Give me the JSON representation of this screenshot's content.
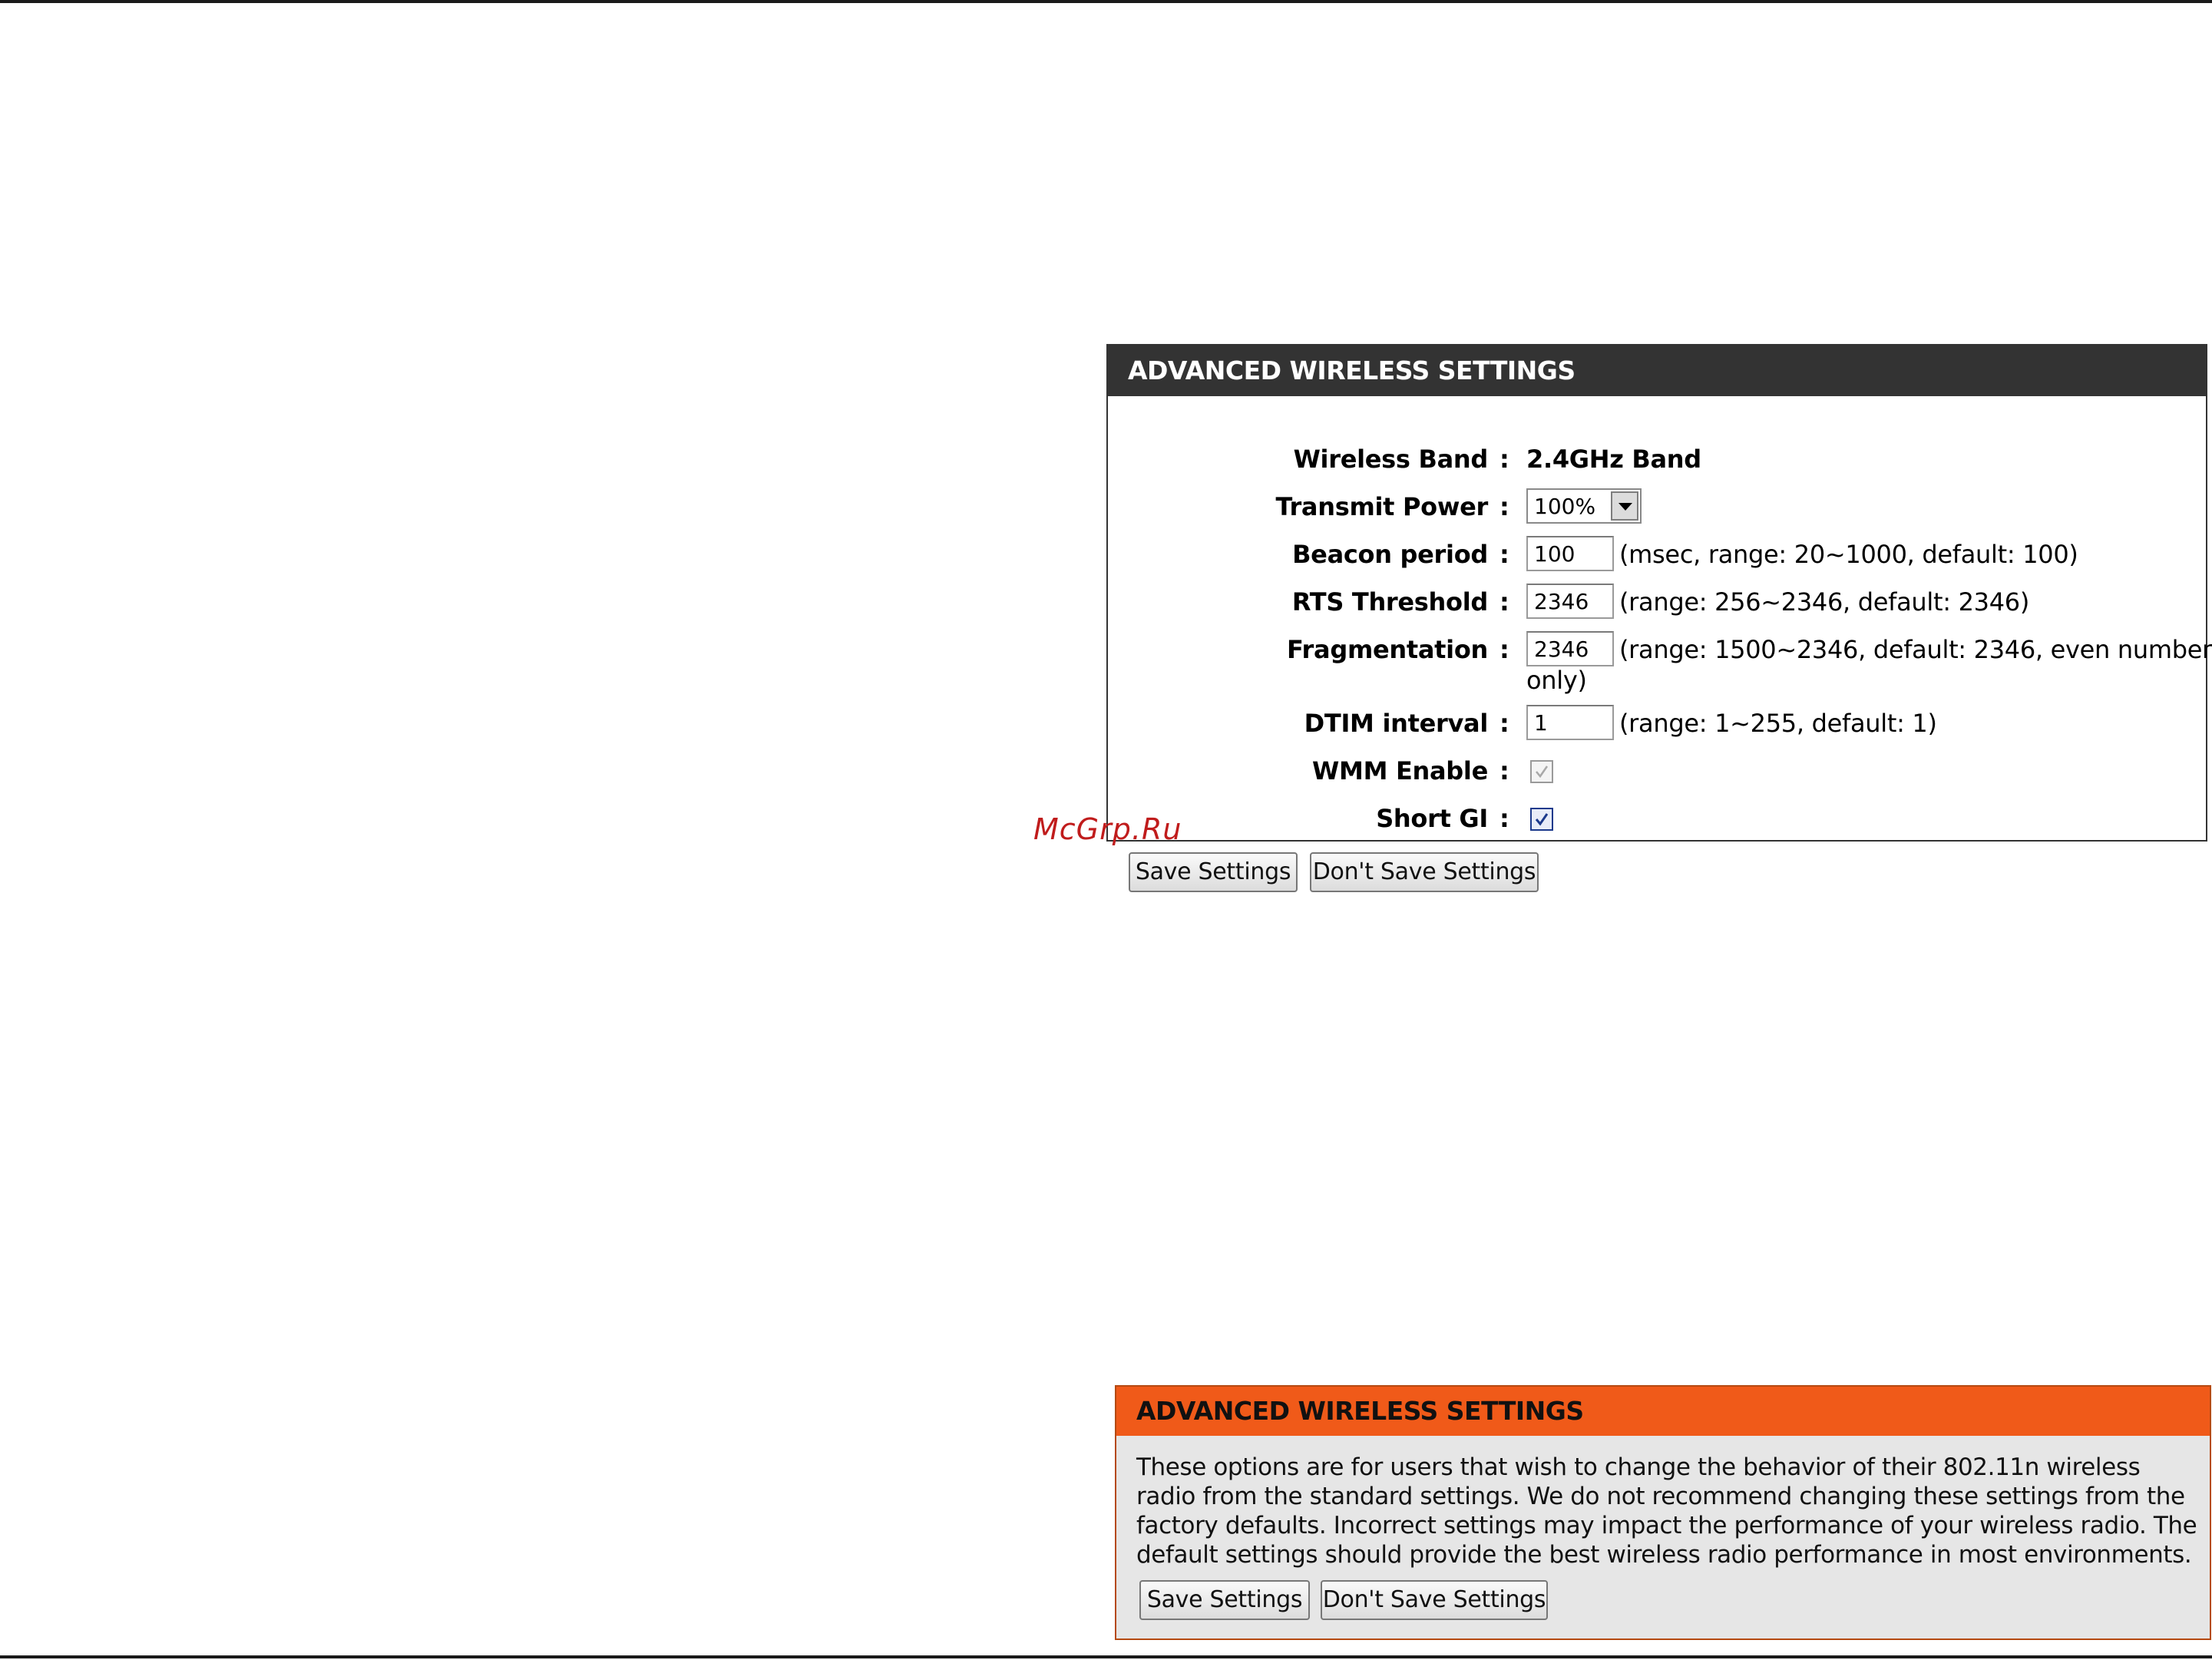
{
  "settings_panel": {
    "title": "ADVANCED WIRELESS SETTINGS",
    "rows": {
      "wireless_band": {
        "label": "Wireless Band",
        "value": "2.4GHz Band"
      },
      "transmit_power": {
        "label": "Transmit Power",
        "value": "100%"
      },
      "beacon_period": {
        "label": "Beacon period",
        "value": "100",
        "hint": "(msec, range: 20~1000, default: 100)"
      },
      "rts_threshold": {
        "label": "RTS Threshold",
        "value": "2346",
        "hint": "(range: 256~2346, default: 2346)"
      },
      "fragmentation": {
        "label": "Fragmentation",
        "value": "2346",
        "hint": "(range: 1500~2346, default: 2346, even number",
        "hint_cont": "only)"
      },
      "dtim_interval": {
        "label": "DTIM interval",
        "value": "1",
        "hint": "(range: 1~255, default: 1)"
      },
      "wmm_enable": {
        "label": "WMM Enable",
        "checked": true,
        "disabled": true
      },
      "short_gi": {
        "label": "Short GI",
        "checked": true,
        "disabled": false
      }
    },
    "colon": ":"
  },
  "buttons": {
    "save": "Save Settings",
    "dont_save": "Don't Save Settings"
  },
  "watermark": "McGrp.Ru",
  "help_panel": {
    "title": "ADVANCED WIRELESS SETTINGS",
    "text": "These options are for users that wish to change the behavior of their 802.11n wireless radio from the standard settings. We do not recommend changing these settings from the factory defaults. Incorrect settings may impact the performance of your wireless radio. The default settings should provide the best wireless radio performance in most environments.",
    "save": "Save Settings",
    "dont_save": "Don't Save Settings"
  },
  "colors": {
    "panel_header": "#333333",
    "help_header": "#f05a19",
    "help_background": "#e6e6e6",
    "watermark": "#c01c1c"
  }
}
